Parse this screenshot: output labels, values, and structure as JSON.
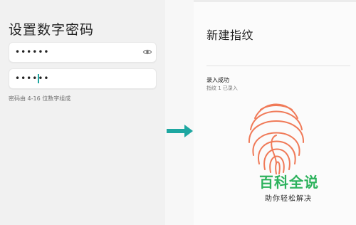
{
  "left": {
    "title": "设置数字密码",
    "field1": {
      "value": "••••••",
      "icon": "eye-icon"
    },
    "field2": {
      "value": "••••••"
    },
    "hint": "密码由 4-16 位数字组成"
  },
  "arrow": {
    "icon": "arrow-right-icon",
    "color": "#1ea7a1"
  },
  "right": {
    "title": "新建指纹",
    "status": "录入成功",
    "substatus": "指纹 1 已录入",
    "fingerprint_icon": "fingerprint-icon",
    "fingerprint_color": "#f07a58"
  },
  "watermark": {
    "brand": "百科全说",
    "subtitle": "助你轻松解决",
    "brand_color": "#2cb25c"
  }
}
